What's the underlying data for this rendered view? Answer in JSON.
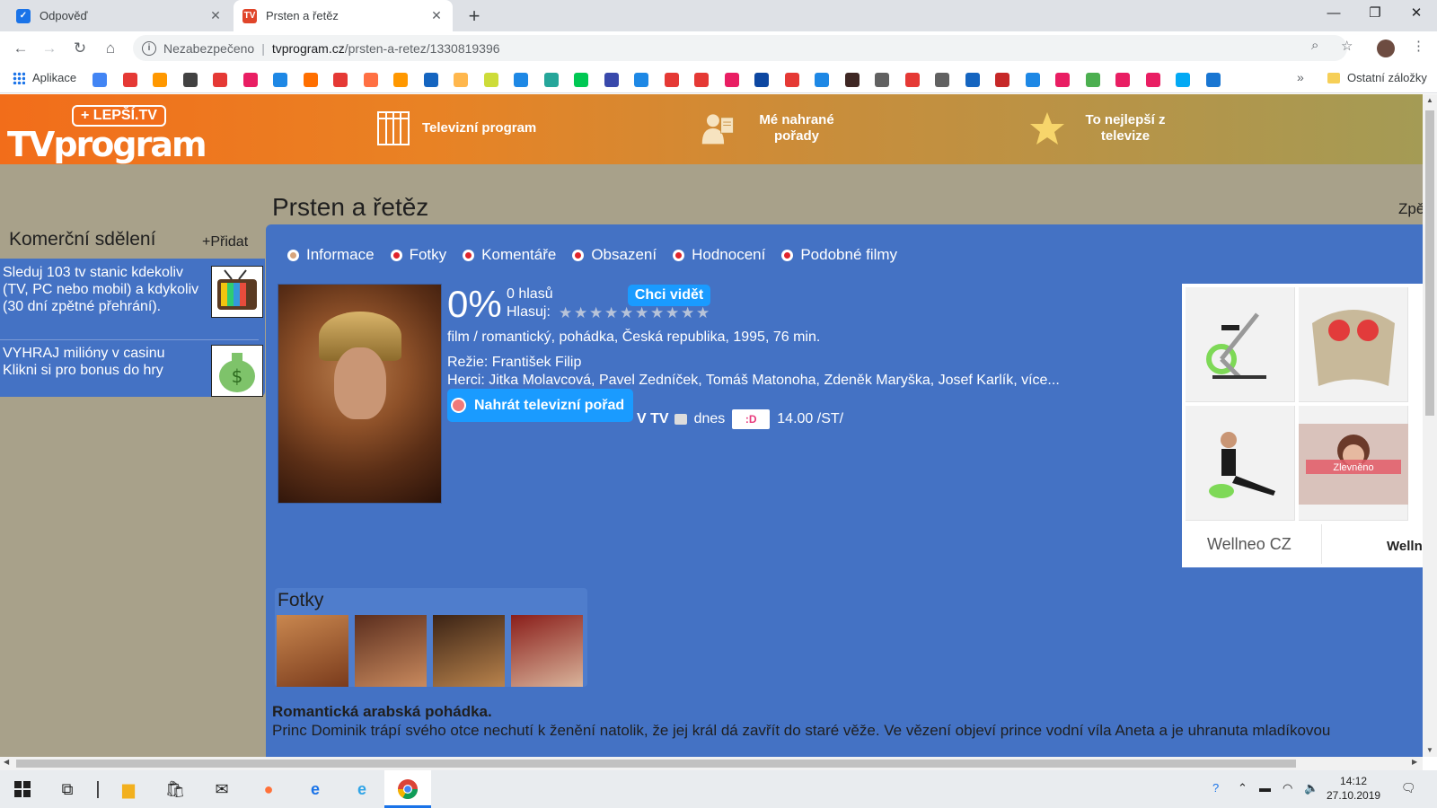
{
  "browser": {
    "tabs": [
      {
        "title": "Odpověď",
        "active": false
      },
      {
        "title": "Prsten a řetěz",
        "active": true
      }
    ],
    "new_tab": "+",
    "address": {
      "security_label": "Nezabezpečeno",
      "host": "tvprogram.cz",
      "path": "/prsten-a-retez/1330819396"
    },
    "bookmarks": {
      "apps_label": "Aplikace",
      "more": "»",
      "other_label": "Ostatní záložky"
    }
  },
  "site": {
    "logo": {
      "badge": "+ LEPŠÍ.TV",
      "wordmark_tv": "TV",
      "wordmark_program": "program"
    },
    "nav": [
      {
        "label": "Televizní program"
      },
      {
        "label": "Mé nahrané pořady"
      },
      {
        "label": "To nejlepší z televize"
      }
    ]
  },
  "sidebar": {
    "title": "Komerční sdělení",
    "add_label": "+Přidat",
    "ads": [
      {
        "text": "Sleduj 103 tv stanic kdekoliv (TV, PC nebo mobil) a kdykoliv (30 dní zpětné přehrání)."
      },
      {
        "text": "VYHRAJ milióny v casinu Klikni si pro bonus do hry"
      }
    ]
  },
  "page": {
    "title": "Prsten a řetěz",
    "back_label": "Zpě",
    "tabs": [
      "Informace",
      "Fotky",
      "Komentáře",
      "Obsazení",
      "Hodnocení",
      "Podobné filmy"
    ],
    "rating": {
      "percent": "0%",
      "votes": "0 hlasů",
      "vote_label": "Hlasuj:",
      "want_label": "Chci vidět",
      "star_count": 10
    },
    "genre_line": "film / romantický, pohádka, Česká republika, 1995, 76 min.",
    "director_line": "Režie: František Filip",
    "cast_line": "Herci: Jitka Molavcová, Pavel Zedníček, Tomáš Matonoha, Zdeněk Maryška, Josef Karlík, více...",
    "record_label": "Nahrát televizní pořad",
    "broadcast": {
      "prefix": "V TV",
      "day": "dnes",
      "station": ":D",
      "time": "14.00 /ST/"
    },
    "promo": {
      "brand": "Wellneo CZ",
      "brand_cut": "Welln",
      "sale_tag": "Zlevněno"
    },
    "photos": {
      "title": "Fotky"
    },
    "description": {
      "headline": "Romantická arabská pohádka.",
      "body": "Princ Dominik trápí svého otce nechutí k ženění natolik, že jej král dá zavřít do staré věže. Ve vězení objeví prince vodní víla Aneta a je uhranuta mladíkovou"
    }
  },
  "taskbar": {
    "time": "14:12",
    "date": "27.10.2019"
  },
  "colors": {
    "page_bg": "#a8a18a",
    "panel_blue": "#4472c4",
    "button_blue": "#1a9bff",
    "header_orange": "#f26d1a"
  }
}
